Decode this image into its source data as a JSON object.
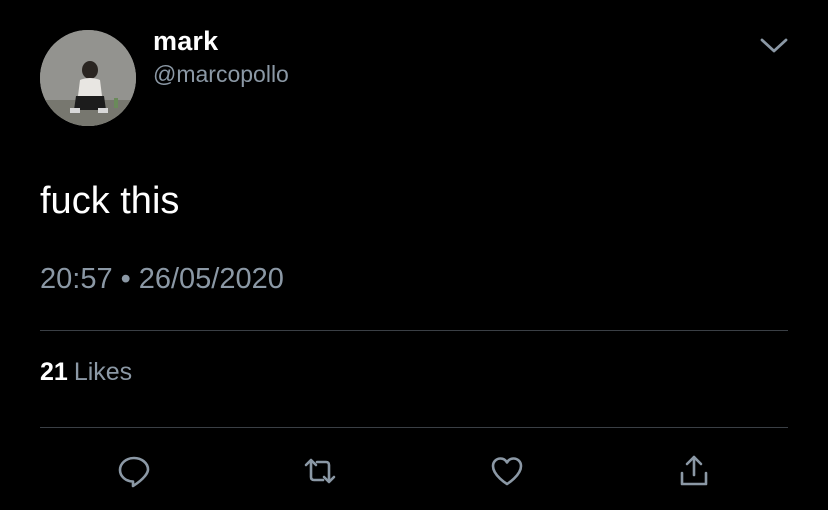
{
  "author": {
    "name": "mark",
    "handle": "@marcopollo"
  },
  "tweet": {
    "text": "fuck this",
    "time": "20:57",
    "separator": "•",
    "date": "26/05/2020"
  },
  "stats": {
    "likes_count": "21",
    "likes_label": "Likes"
  },
  "actions": [
    "reply-icon",
    "retweet-icon",
    "heart-icon",
    "share-icon"
  ],
  "colors": {
    "background": "#000000",
    "primary_text": "#ffffff",
    "secondary_text": "#8b98a5",
    "divider": "#3a3f45"
  }
}
